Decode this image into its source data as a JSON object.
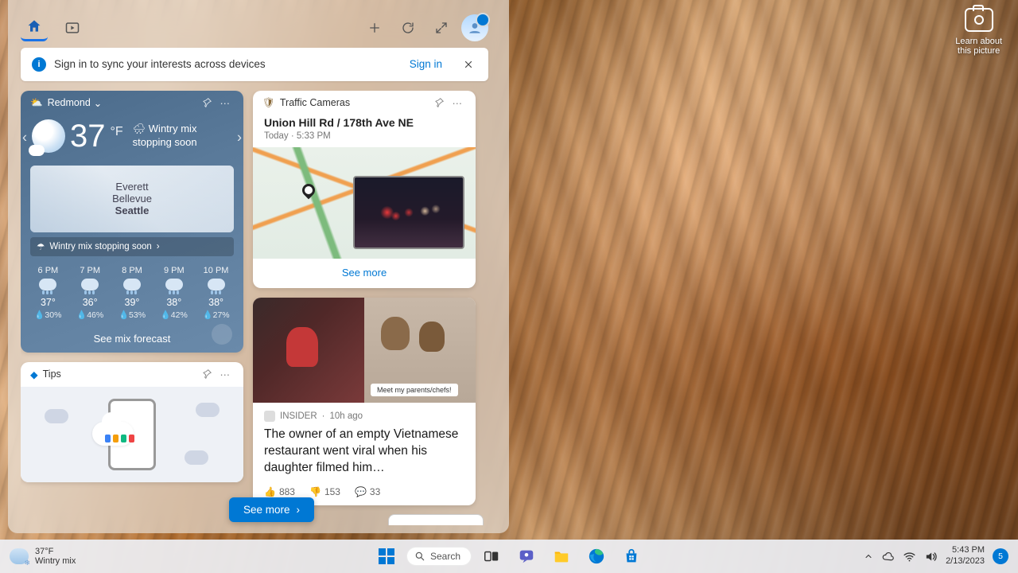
{
  "desktop": {
    "learn_about_line1": "Learn about",
    "learn_about_line2": "this picture"
  },
  "widgets": {
    "signin": {
      "message": "Sign in to sync your interests across devices",
      "link": "Sign in"
    },
    "weather": {
      "location": "Redmond",
      "temp": "37",
      "unit": "°F",
      "condition_prefix": "🌧 Wintry mix",
      "condition_line2": "stopping soon",
      "map_city1": "Everett",
      "map_city2": "Bellevue",
      "map_city3": "Seattle",
      "alert": "Wintry mix stopping soon",
      "hours": [
        {
          "t": "6 PM",
          "temp": "37°",
          "prec": "💧30%"
        },
        {
          "t": "7 PM",
          "temp": "36°",
          "prec": "💧46%"
        },
        {
          "t": "8 PM",
          "temp": "39°",
          "prec": "💧53%"
        },
        {
          "t": "9 PM",
          "temp": "38°",
          "prec": "💧42%"
        },
        {
          "t": "10 PM",
          "temp": "38°",
          "prec": "💧27%"
        }
      ],
      "see_forecast": "See mix forecast"
    },
    "tips": {
      "title": "Tips"
    },
    "traffic": {
      "title": "Traffic Cameras",
      "cam_name": "Union Hill Rd / 178th Ave NE",
      "cam_time": "Today · 5:33 PM",
      "see_more": "See more"
    },
    "news": {
      "source": "INSIDER",
      "time": "10h ago",
      "caption": "Meet my parents/chefs!",
      "headline": "The owner of an empty Vietnamese restaurant went viral when his daughter filmed him…",
      "likes": "883",
      "dislikes": "153",
      "comments": "33"
    },
    "see_more_btn": "See more"
  },
  "taskbar": {
    "weather_temp": "37°F",
    "weather_cond": "Wintry mix",
    "search": "Search",
    "time": "5:43 PM",
    "date": "2/13/2023",
    "notif_count": "5"
  }
}
